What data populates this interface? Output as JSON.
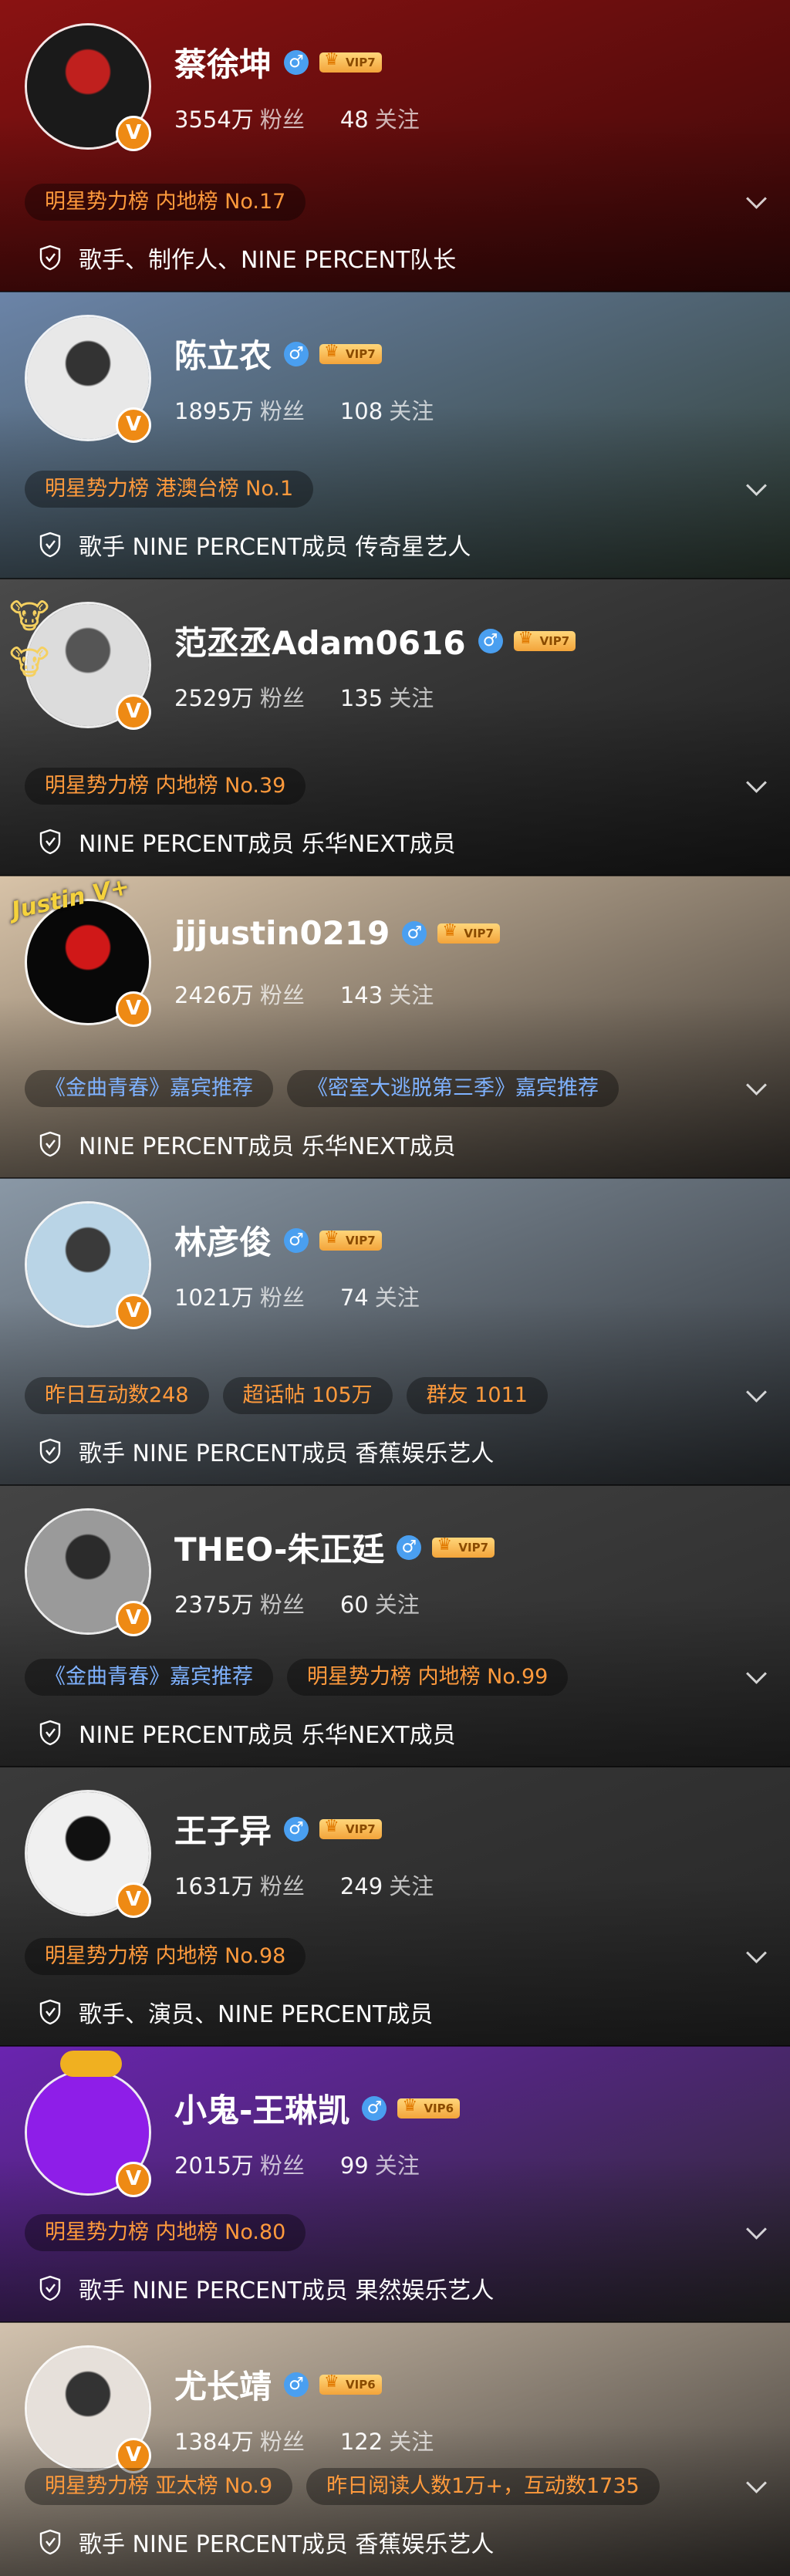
{
  "profiles": [
    {
      "name": "蔡徐坤",
      "gender": "♂",
      "vip": "VIP7",
      "followers_num": "3554万",
      "followers_label": "粉丝",
      "following_num": "48",
      "following_label": "关注",
      "tags": [
        {
          "text": "明星势力榜 内地榜 No.17",
          "color": "orange"
        }
      ],
      "verify": "歌手、制作人、NINE PERCENT队长",
      "bg": "#8a1212",
      "bg2": "#3a0808",
      "avatar_color": "#1a1a1a",
      "avatar_accent": "#c0201e",
      "decor": ""
    },
    {
      "name": "陈立农",
      "gender": "♂",
      "vip": "VIP7",
      "followers_num": "1895万",
      "followers_label": "粉丝",
      "following_num": "108",
      "following_label": "关注",
      "tags": [
        {
          "text": "明星势力榜 港澳台榜 No.1",
          "color": "orange"
        }
      ],
      "verify": "歌手 NINE PERCENT成员 传奇星艺人",
      "bg": "#6b84a8",
      "bg2": "#2f3d33",
      "avatar_color": "#e8e8e8",
      "avatar_accent": "#333",
      "decor": ""
    },
    {
      "name": "范丞丞Adam0616",
      "gender": "♂",
      "vip": "VIP7",
      "followers_num": "2529万",
      "followers_label": "粉丝",
      "following_num": "135",
      "following_label": "关注",
      "tags": [
        {
          "text": "明星势力榜 内地榜 No.39",
          "color": "orange"
        }
      ],
      "verify": "NINE PERCENT成员 乐华NEXT成员",
      "bg": "#4a4a4a",
      "bg2": "#1c1c1c",
      "avatar_color": "#dcdcdc",
      "avatar_accent": "#555",
      "decor": "cows"
    },
    {
      "name": "jjjustin0219",
      "gender": "♂",
      "vip": "VIP7",
      "followers_num": "2426万",
      "followers_label": "粉丝",
      "following_num": "143",
      "following_label": "关注",
      "tags": [
        {
          "text": "《金曲青春》嘉宾推荐",
          "color": "blue"
        },
        {
          "text": "《密室大逃脱第三季》嘉宾推荐",
          "color": "blue"
        }
      ],
      "verify": "NINE PERCENT成员 乐华NEXT成员",
      "bg": "#d8c3a8",
      "bg2": "#3a3530",
      "avatar_color": "#080808",
      "avatar_accent": "#d01818",
      "decor": "justin",
      "decor_text": "Justin V+"
    },
    {
      "name": "林彦俊",
      "gender": "♂",
      "vip": "VIP7",
      "followers_num": "1021万",
      "followers_label": "粉丝",
      "following_num": "74",
      "following_label": "关注",
      "tags": [
        {
          "text": "昨日互动数248",
          "color": "orange"
        },
        {
          "text": "超话帖 105万",
          "color": "orange"
        },
        {
          "text": "群友 1011",
          "color": "orange"
        }
      ],
      "verify": "歌手 NINE PERCENT成员 香蕉娱乐艺人",
      "bg": "#8a98a6",
      "bg2": "#2e3236",
      "avatar_color": "#b9d4e6",
      "avatar_accent": "#3a3a3a",
      "decor": ""
    },
    {
      "name": "THEO-朱正廷",
      "gender": "♂",
      "vip": "VIP7",
      "followers_num": "2375万",
      "followers_label": "粉丝",
      "following_num": "60",
      "following_label": "关注",
      "tags": [
        {
          "text": "《金曲青春》嘉宾推荐",
          "color": "blue"
        },
        {
          "text": "明星势力榜 内地榜 No.99",
          "color": "orange"
        }
      ],
      "verify": "NINE PERCENT成员 乐华NEXT成员",
      "bg": "#444",
      "bg2": "#2a2a2a",
      "avatar_color": "#9a9a9a",
      "avatar_accent": "#2b2b2b",
      "decor": ""
    },
    {
      "name": "王子异",
      "gender": "♂",
      "vip": "VIP7",
      "followers_num": "1631万",
      "followers_label": "粉丝",
      "following_num": "249",
      "following_label": "关注",
      "tags": [
        {
          "text": "明星势力榜 内地榜 No.98",
          "color": "orange"
        }
      ],
      "verify": "歌手、演员、NINE PERCENT成员",
      "bg": "#3a3a3a",
      "bg2": "#262626",
      "avatar_color": "#f0f0f0",
      "avatar_accent": "#111",
      "decor": ""
    },
    {
      "name": "小鬼-王琳凯",
      "gender": "♂",
      "vip": "VIP6",
      "followers_num": "2015万",
      "followers_label": "粉丝",
      "following_num": "99",
      "following_label": "关注",
      "tags": [
        {
          "text": "明星势力榜 内地榜 No.80",
          "color": "orange"
        }
      ],
      "verify": "歌手 NINE PERCENT成员 果然娱乐艺人",
      "bg": "#6a24b0",
      "bg2": "#2a2a2a",
      "avatar_color": "#8e1ee8",
      "avatar_accent": "#8e1ee8",
      "decor": "cloud"
    },
    {
      "name": "尤长靖",
      "gender": "♂",
      "vip": "VIP6",
      "followers_num": "1384万",
      "followers_label": "粉丝",
      "following_num": "122",
      "following_label": "关注",
      "tags": [
        {
          "text": "明星势力榜 亚太榜 No.9",
          "color": "orange"
        },
        {
          "text": "昨日阅读人数1万+，互动数1735",
          "color": "orange"
        }
      ],
      "verify": "歌手 NINE PERCENT成员 香蕉娱乐艺人",
      "bg": "#d2c2ae",
      "bg2": "#3a3632",
      "avatar_color": "#e6e0da",
      "avatar_accent": "#333",
      "decor": ""
    }
  ]
}
